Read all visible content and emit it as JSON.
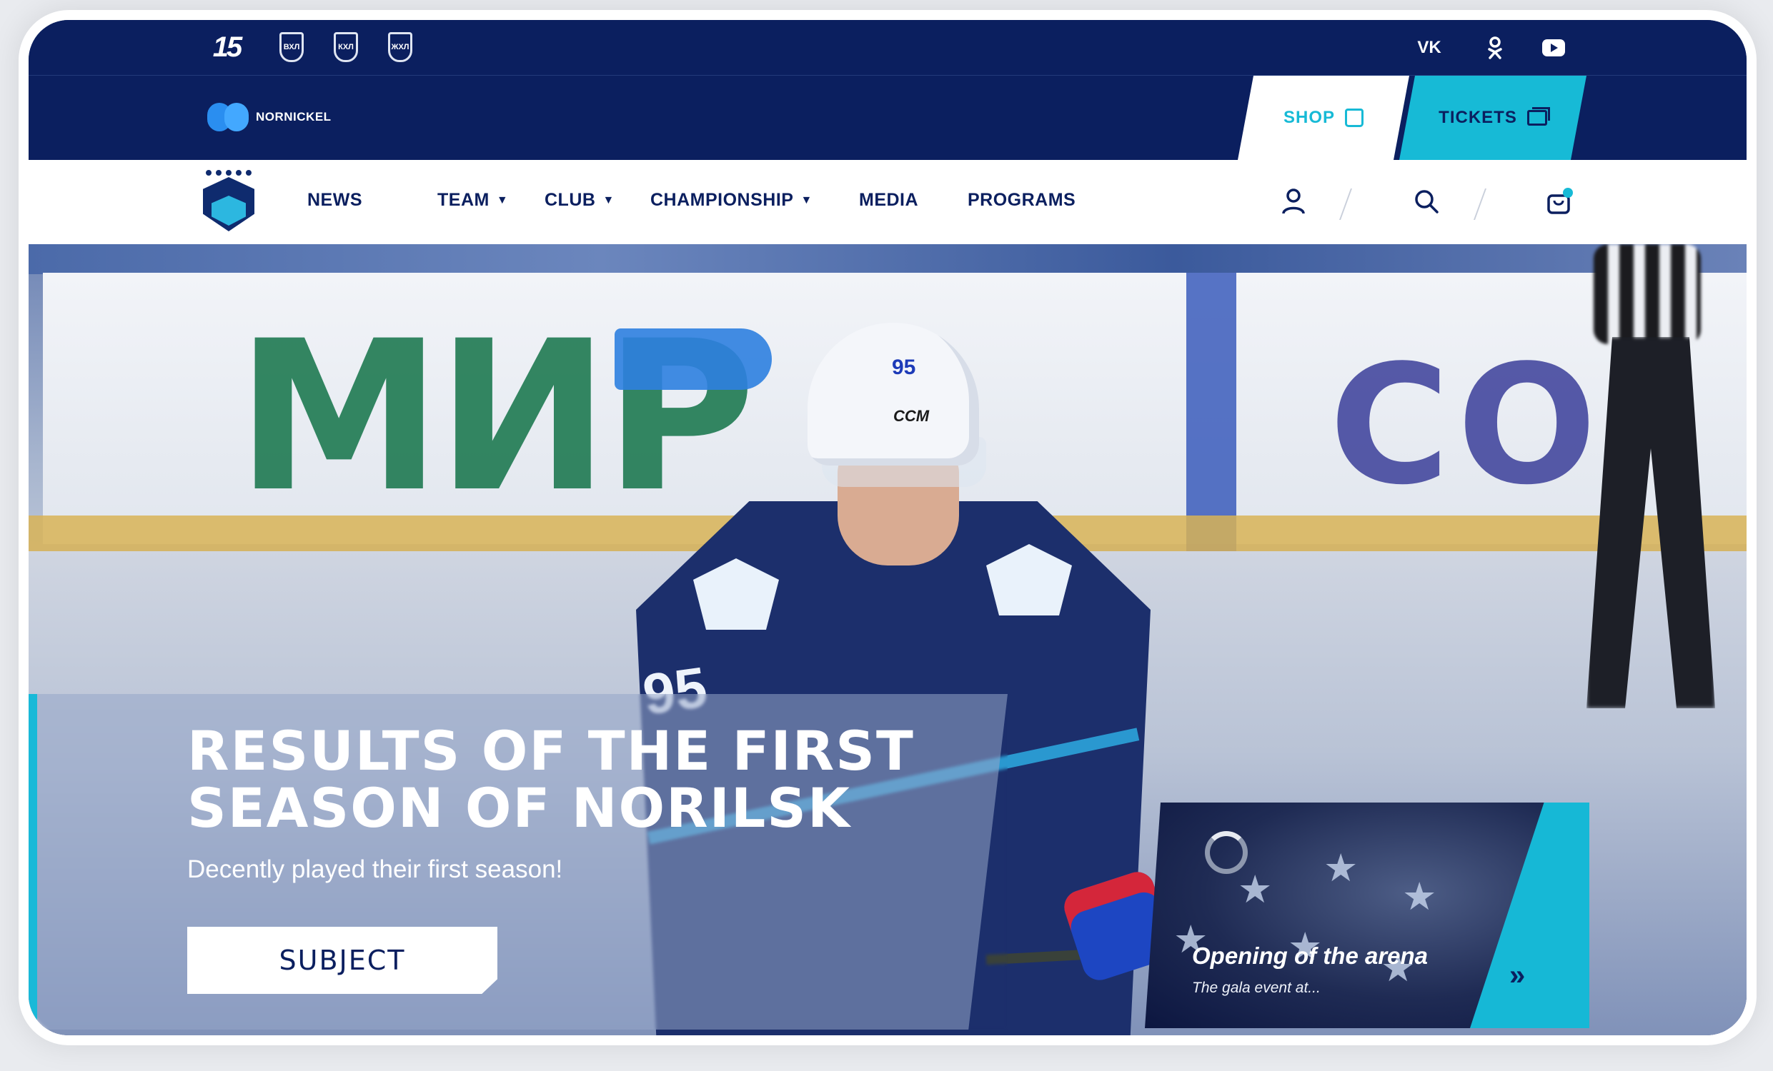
{
  "league_bar": {
    "logos": [
      {
        "icon": "anniversary-15-logo-icon",
        "text": "15"
      },
      {
        "icon": "vhl-logo-icon",
        "text": "ВХЛ"
      },
      {
        "icon": "khl-logo-icon",
        "text": "КХЛ"
      },
      {
        "icon": "zhhl-logo-icon",
        "text": "ЖХЛ"
      }
    ],
    "social": [
      {
        "icon": "vk-icon",
        "text": "VK"
      },
      {
        "icon": "odnoklassniki-icon"
      },
      {
        "icon": "youtube-icon"
      }
    ]
  },
  "sponsor": {
    "name": "NORNICKEL",
    "shop_label": "SHOP",
    "tickets_label": "TICKETS"
  },
  "nav": {
    "items": [
      {
        "label": "NEWS",
        "dropdown": false
      },
      {
        "label": "TEAM",
        "dropdown": true
      },
      {
        "label": "CLUB",
        "dropdown": true
      },
      {
        "label": "CHAMPIONSHIP",
        "dropdown": true
      },
      {
        "label": "MEDIA",
        "dropdown": false
      },
      {
        "label": "PROGRAMS",
        "dropdown": false
      }
    ],
    "caret": "▼",
    "icons": [
      "user-icon",
      "search-icon",
      "cart-icon"
    ]
  },
  "hero": {
    "background_text": {
      "left": "МИР",
      "right": "СО"
    },
    "player": {
      "helmet_number": "95",
      "helmet_brand": "CCM",
      "jersey_number": "95"
    },
    "title": "RESULTS OF THE FIRST SEASON OF NORILSK",
    "subtitle": "Decently played their first season!",
    "button_label": "SUBJECT"
  },
  "side_card": {
    "title": "Opening of the arena",
    "subtitle": "The gala event at...",
    "arrow": "»"
  },
  "colors": {
    "navy": "#0b1f5f",
    "accent": "#17bad6",
    "white": "#ffffff"
  }
}
